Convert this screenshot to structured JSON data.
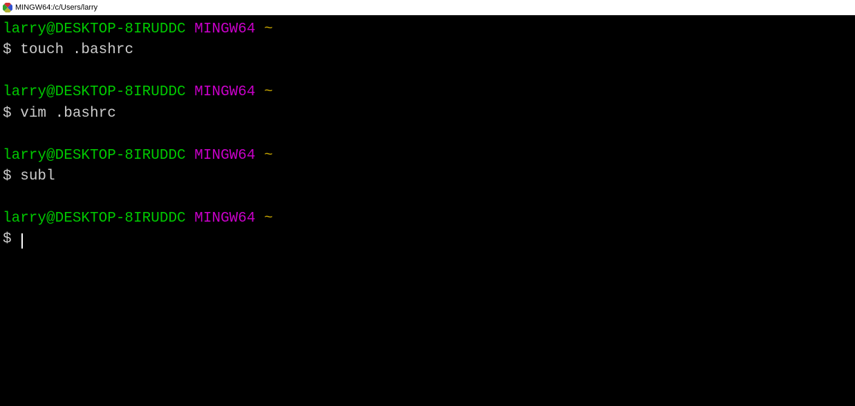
{
  "window": {
    "title": "MINGW64:/c/Users/larry"
  },
  "prompt": {
    "user_host": "larry@DESKTOP-8IRUDDC",
    "shell": "MINGW64",
    "path": "~",
    "symbol": "$"
  },
  "history": [
    {
      "command": "touch .bashrc"
    },
    {
      "command": "vim .bashrc"
    },
    {
      "command": "subl"
    }
  ],
  "current": {
    "command": ""
  }
}
